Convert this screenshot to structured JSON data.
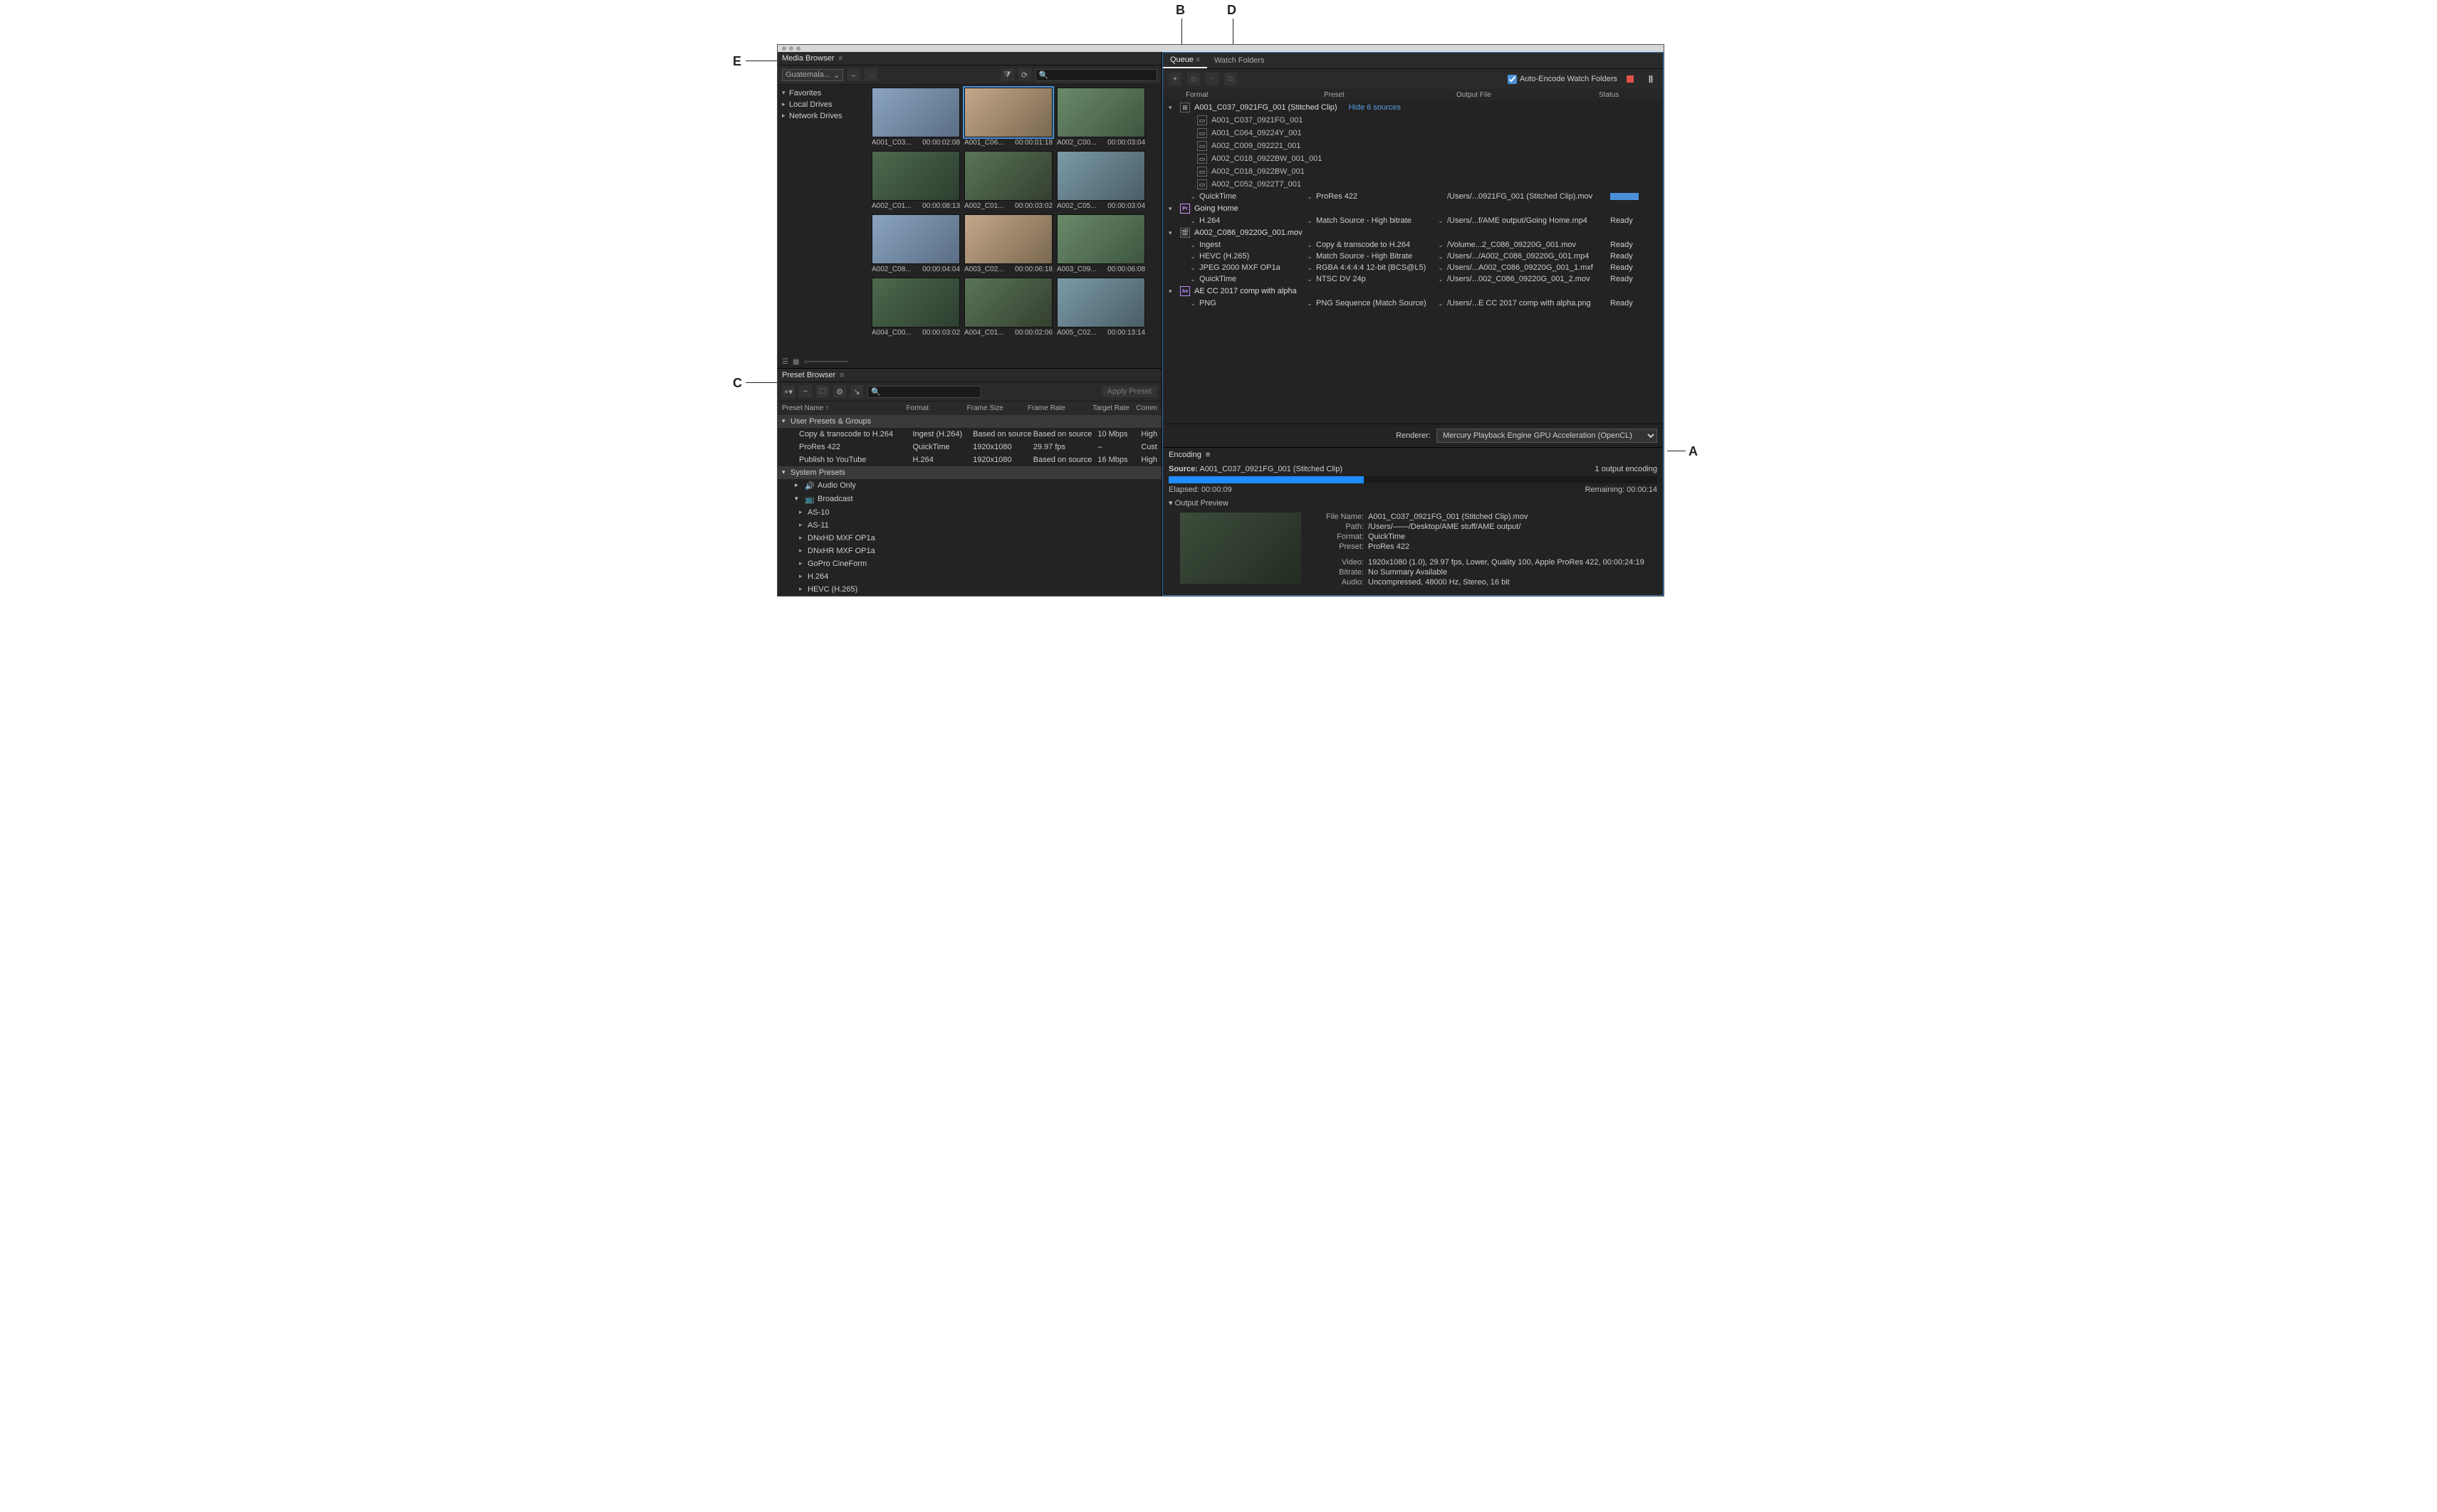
{
  "callouts": {
    "A": "A",
    "B": "B",
    "C": "C",
    "D": "D",
    "E": "E"
  },
  "mediaBrowser": {
    "title": "Media Browser",
    "path": "Guatemala...",
    "searchPlaceholder": "",
    "tree": [
      {
        "label": "Favorites",
        "twisty": "▾"
      },
      {
        "label": "Local Drives",
        "twisty": "▸"
      },
      {
        "label": "Network Drives",
        "twisty": "▸"
      }
    ],
    "thumbs": [
      [
        {
          "name": "A001_C03...",
          "dur": "00:00:02:08"
        },
        {
          "name": "A001_C06...",
          "dur": "00:00:01:18",
          "sel": true
        },
        {
          "name": "A002_C00...",
          "dur": "00:00:03:04"
        }
      ],
      [
        {
          "name": "A002_C01...",
          "dur": "00:00:08:13"
        },
        {
          "name": "A002_C01...",
          "dur": "00:00:03:02"
        },
        {
          "name": "A002_C05...",
          "dur": "00:00:03:04"
        }
      ],
      [
        {
          "name": "A002_C08...",
          "dur": "00:00:04:04"
        },
        {
          "name": "A003_C02...",
          "dur": "00:00:06:18"
        },
        {
          "name": "A003_C09...",
          "dur": "00:00:06:08"
        }
      ],
      [
        {
          "name": "A004_C00...",
          "dur": "00:00:03:02"
        },
        {
          "name": "A004_C01...",
          "dur": "00:00:02:06"
        },
        {
          "name": "A005_C02...",
          "dur": "00:00:13:14"
        }
      ]
    ]
  },
  "presetBrowser": {
    "title": "Preset Browser",
    "applyLabel": "Apply Preset",
    "cols": {
      "name": "Preset Name ↑",
      "format": "Format",
      "size": "Frame Size",
      "rate": "Frame Rate",
      "target": "Target Rate",
      "comm": "Comm"
    },
    "userGroup": "User Presets & Groups",
    "userPresets": [
      {
        "name": "Copy & transcode to H.264",
        "format": "Ingest (H.264)",
        "size": "Based on source",
        "rate": "Based on source",
        "target": "10 Mbps",
        "comm": "High"
      },
      {
        "name": "ProRes 422",
        "format": "QuickTime",
        "size": "1920x1080",
        "rate": "29.97 fps",
        "target": "–",
        "comm": "Cust"
      },
      {
        "name": "Publish to YouTube",
        "format": "H.264",
        "size": "1920x1080",
        "rate": "Based on source",
        "target": "16 Mbps",
        "comm": "High"
      }
    ],
    "sysGroup": "System Presets",
    "sysCats": [
      {
        "icon": "🔊",
        "label": "Audio Only",
        "twisty": "▸"
      },
      {
        "icon": "📺",
        "label": "Broadcast",
        "twisty": "▾",
        "children": [
          "AS-10",
          "AS-11",
          "DNxHD MXF OP1a",
          "DNxHR MXF OP1a",
          "GoPro CineForm",
          "H.264",
          "HEVC (H.265)"
        ]
      }
    ]
  },
  "queue": {
    "tabs": {
      "queue": "Queue",
      "watch": "Watch Folders"
    },
    "autoEncode": "Auto-Encode Watch Folders",
    "cols": {
      "format": "Format",
      "preset": "Preset",
      "output": "Output File",
      "status": "Status"
    },
    "rendererLabel": "Renderer:",
    "rendererValue": "Mercury Playback Engine GPU Acceleration (OpenCL)",
    "items": [
      {
        "type": "stitch",
        "label": "A001_C037_0921FG_001 (Stitched Clip)",
        "action": "Hide 6 sources",
        "sources": [
          "A001_C037_0921FG_001",
          "A001_C064_09224Y_001",
          "A002_C009_092221_001",
          "A002_C018_0922BW_001_001",
          "A002_C018_0922BW_001",
          "A002_C052_0922T7_001"
        ],
        "outputs": [
          {
            "fmt": "QuickTime",
            "preset": "ProRes 422",
            "file": "/Users/...0921FG_001 (Stitched Clip).mov",
            "status": "progress",
            "link": false
          }
        ]
      },
      {
        "type": "pr",
        "label": "Going Home",
        "outputs": [
          {
            "fmt": "H.264",
            "preset": "Match Source - High bitrate",
            "file": "/Users/...f/AME output/Going Home.mp4",
            "status": "Ready",
            "link": true
          }
        ]
      },
      {
        "type": "clip",
        "label": "A002_C086_09220G_001.mov",
        "outputs": [
          {
            "fmt": "Ingest",
            "preset": "Copy & transcode to H.264",
            "file": "/Volume...2_C086_09220G_001.mov",
            "status": "Ready",
            "link": true
          },
          {
            "fmt": "HEVC (H.265)",
            "preset": "Match Source - High Bitrate",
            "file": "/Users/.../A002_C086_09220G_001.mp4",
            "status": "Ready",
            "link": true
          },
          {
            "fmt": "JPEG 2000 MXF OP1a",
            "preset": "RGBA 4:4:4:4 12-bit (BCS@L5)",
            "file": "/Users/...A002_C086_09220G_001_1.mxf",
            "status": "Ready",
            "link": true
          },
          {
            "fmt": "QuickTime",
            "preset": "NTSC DV 24p",
            "file": "/Users/...002_C086_09220G_001_2.mov",
            "status": "Ready",
            "link": true
          }
        ]
      },
      {
        "type": "ae",
        "label": "AE CC 2017 comp with alpha",
        "outputs": [
          {
            "fmt": "PNG",
            "preset": "PNG Sequence (Match Source)",
            "file": "/Users/...E CC 2017 comp with alpha.png",
            "status": "Ready",
            "link": true
          }
        ]
      }
    ]
  },
  "encoding": {
    "title": "Encoding",
    "sourceLabel": "Source:",
    "source": "A001_C037_0921FG_001 (Stitched Clip)",
    "countLabel": "1 output encoding",
    "elapsedLabel": "Elapsed:",
    "elapsed": "00:00:09",
    "remainingLabel": "Remaining:",
    "remaining": "00:00:14",
    "previewLabel": "Output Preview",
    "meta": {
      "fileNameLabel": "File Name:",
      "fileName": "A001_C037_0921FG_001 (Stitched Clip).mov",
      "pathLabel": "Path:",
      "path": "/Users/——/Desktop/AME stuff/AME output/",
      "formatLabel": "Format:",
      "format": "QuickTime",
      "presetLabel": "Preset:",
      "preset": "ProRes 422",
      "videoLabel": "Video:",
      "video": "1920x1080 (1.0), 29.97 fps, Lower, Quality 100, Apple ProRes 422, 00:00:24:19",
      "bitrateLabel": "Bitrate:",
      "bitrate": "No Summary Available",
      "audioLabel": "Audio:",
      "audio": "Uncompressed, 48000 Hz, Stereo, 16 bit"
    }
  }
}
